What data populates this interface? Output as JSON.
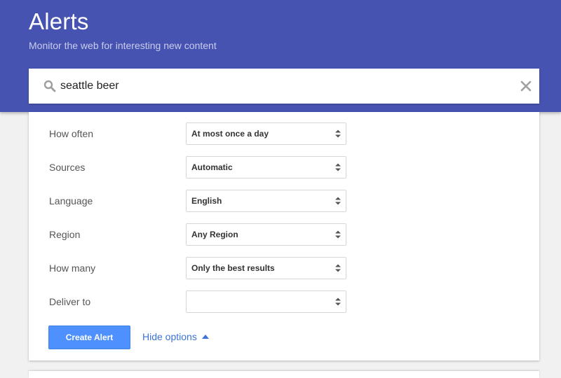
{
  "header": {
    "title": "Alerts",
    "subtitle": "Monitor the web for interesting new content",
    "background_color": "#4653b1"
  },
  "search": {
    "value": "seattle beer",
    "search_icon": "search-icon",
    "clear_icon": "close-icon"
  },
  "options": {
    "rows": [
      {
        "label": "How often",
        "value": "At most once a day"
      },
      {
        "label": "Sources",
        "value": "Automatic"
      },
      {
        "label": "Language",
        "value": "English"
      },
      {
        "label": "Region",
        "value": "Any Region"
      },
      {
        "label": "How many",
        "value": "Only the best results"
      },
      {
        "label": "Deliver to",
        "value": ""
      }
    ]
  },
  "actions": {
    "create_label": "Create Alert",
    "hide_options_label": "Hide options",
    "hide_options_icon": "caret-up-icon",
    "accent_color": "#4d90fe",
    "link_color": "#3b73d6"
  }
}
